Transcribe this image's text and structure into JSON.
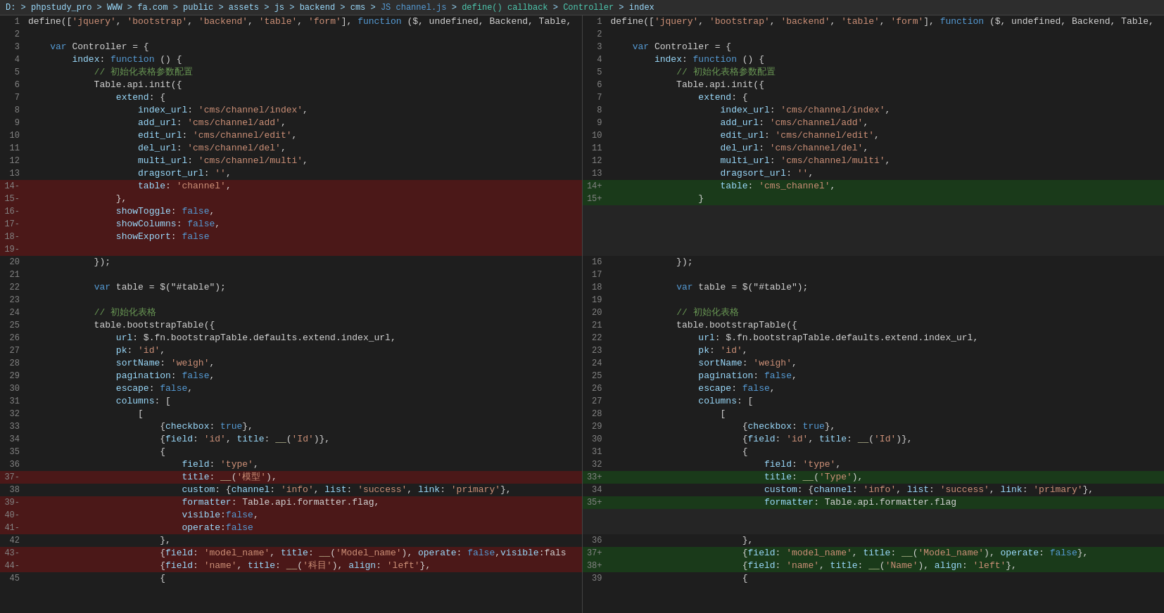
{
  "breadcrumb": {
    "items": [
      "D:",
      "phpstudy_pro",
      "WWW",
      "fa.com",
      "public",
      "assets",
      "js",
      "backend",
      "cms",
      "JS channel.js",
      "define() callback",
      "Controller",
      "index"
    ]
  },
  "left_pane": {
    "lines": [
      {
        "num": 1,
        "type": "normal",
        "content": "define(['jquery', 'bootstrap', 'backend', 'table', 'form'], function ($, undefined, Backend, Table,"
      },
      {
        "num": 2,
        "type": "normal",
        "content": ""
      },
      {
        "num": 3,
        "type": "normal",
        "content": "    var Controller = {"
      },
      {
        "num": 4,
        "type": "normal",
        "content": "        index: function () {"
      },
      {
        "num": 5,
        "type": "normal",
        "content": "            // 初始化表格参数配置"
      },
      {
        "num": 6,
        "type": "normal",
        "content": "            Table.api.init({"
      },
      {
        "num": 7,
        "type": "normal",
        "content": "                extend: {"
      },
      {
        "num": 8,
        "type": "normal",
        "content": "                    index_url: 'cms/channel/index',"
      },
      {
        "num": 9,
        "type": "normal",
        "content": "                    add_url: 'cms/channel/add',"
      },
      {
        "num": 10,
        "type": "normal",
        "content": "                    edit_url: 'cms/channel/edit',"
      },
      {
        "num": 11,
        "type": "normal",
        "content": "                    del_url: 'cms/channel/del',"
      },
      {
        "num": 12,
        "type": "normal",
        "content": "                    multi_url: 'cms/channel/multi',"
      },
      {
        "num": 13,
        "type": "normal",
        "content": "                    dragsort_url: '',"
      },
      {
        "num": "14-",
        "type": "deleted",
        "content": "                    table: 'channel',"
      },
      {
        "num": "15-",
        "type": "deleted",
        "content": "                },"
      },
      {
        "num": "16-",
        "type": "deleted",
        "content": "                showToggle: false,"
      },
      {
        "num": "17-",
        "type": "deleted",
        "content": "                showColumns: false,"
      },
      {
        "num": "18-",
        "type": "deleted",
        "content": "                showExport: false"
      },
      {
        "num": "19-",
        "type": "deleted",
        "content": ""
      },
      {
        "num": 20,
        "type": "normal",
        "content": "            });"
      },
      {
        "num": 21,
        "type": "normal",
        "content": ""
      },
      {
        "num": 22,
        "type": "normal",
        "content": "            var table = $(\"#table\");"
      },
      {
        "num": 23,
        "type": "normal",
        "content": ""
      },
      {
        "num": 24,
        "type": "normal",
        "content": "            // 初始化表格"
      },
      {
        "num": 25,
        "type": "normal",
        "content": "            table.bootstrapTable({"
      },
      {
        "num": 26,
        "type": "normal",
        "content": "                url: $.fn.bootstrapTable.defaults.extend.index_url,"
      },
      {
        "num": 27,
        "type": "normal",
        "content": "                pk: 'id',"
      },
      {
        "num": 28,
        "type": "normal",
        "content": "                sortName: 'weigh',"
      },
      {
        "num": 29,
        "type": "normal",
        "content": "                pagination: false,"
      },
      {
        "num": 30,
        "type": "normal",
        "content": "                escape: false,"
      },
      {
        "num": 31,
        "type": "normal",
        "content": "                columns: ["
      },
      {
        "num": 32,
        "type": "normal",
        "content": "                    ["
      },
      {
        "num": 33,
        "type": "normal",
        "content": "                        {checkbox: true},"
      },
      {
        "num": 34,
        "type": "normal",
        "content": "                        {field: 'id', title: __('Id')},"
      },
      {
        "num": 35,
        "type": "normal",
        "content": "                        {"
      },
      {
        "num": 36,
        "type": "normal",
        "content": "                            field: 'type',"
      },
      {
        "num": "37-",
        "type": "deleted",
        "content": "                            title: __('模型'),"
      },
      {
        "num": 38,
        "type": "normal",
        "content": "                            custom: {channel: 'info', list: 'success', link: 'primary'},"
      },
      {
        "num": "39-",
        "type": "deleted",
        "content": "                            formatter: Table.api.formatter.flag,"
      },
      {
        "num": "40-",
        "type": "deleted",
        "content": "                            visible:false,"
      },
      {
        "num": "41-",
        "type": "deleted",
        "content": "                            operate:false"
      },
      {
        "num": 42,
        "type": "normal",
        "content": "                        },"
      },
      {
        "num": "43-",
        "type": "deleted",
        "content": "                        {field: 'model_name', title: __('Model_name'), operate: false,visible:fals"
      },
      {
        "num": "44-",
        "type": "deleted",
        "content": "                        {field: 'name', title: __('科目'), align: 'left'},"
      },
      {
        "num": 45,
        "type": "normal",
        "content": "                        {"
      }
    ]
  },
  "right_pane": {
    "lines": [
      {
        "num": 1,
        "type": "normal",
        "content": "define(['jquery', 'bootstrap', 'backend', 'table', 'form'], function ($, undefined, Backend, Table,"
      },
      {
        "num": 2,
        "type": "normal",
        "content": ""
      },
      {
        "num": 3,
        "type": "normal",
        "content": "    var Controller = {"
      },
      {
        "num": 4,
        "type": "normal",
        "content": "        index: function () {"
      },
      {
        "num": 5,
        "type": "normal",
        "content": "            // 初始化表格参数配置"
      },
      {
        "num": 6,
        "type": "normal",
        "content": "            Table.api.init({"
      },
      {
        "num": 7,
        "type": "normal",
        "content": "                extend: {"
      },
      {
        "num": 8,
        "type": "normal",
        "content": "                    index_url: 'cms/channel/index',"
      },
      {
        "num": 9,
        "type": "normal",
        "content": "                    add_url: 'cms/channel/add',"
      },
      {
        "num": 10,
        "type": "normal",
        "content": "                    edit_url: 'cms/channel/edit',"
      },
      {
        "num": 11,
        "type": "normal",
        "content": "                    del_url: 'cms/channel/del',"
      },
      {
        "num": 12,
        "type": "normal",
        "content": "                    multi_url: 'cms/channel/multi',"
      },
      {
        "num": 13,
        "type": "normal",
        "content": "                    dragsort_url: '',"
      },
      {
        "num": "14+",
        "type": "added",
        "content": "                    table: 'cms_channel',"
      },
      {
        "num": "15+",
        "type": "added",
        "content": "                }"
      },
      {
        "num": "",
        "type": "empty",
        "content": ""
      },
      {
        "num": "",
        "type": "empty",
        "content": ""
      },
      {
        "num": "",
        "type": "empty",
        "content": ""
      },
      {
        "num": "",
        "type": "empty",
        "content": ""
      },
      {
        "num": 16,
        "type": "normal",
        "content": "            });"
      },
      {
        "num": 17,
        "type": "normal",
        "content": ""
      },
      {
        "num": 18,
        "type": "normal",
        "content": "            var table = $(\"#table\");"
      },
      {
        "num": 19,
        "type": "normal",
        "content": ""
      },
      {
        "num": 20,
        "type": "normal",
        "content": "            // 初始化表格"
      },
      {
        "num": 21,
        "type": "normal",
        "content": "            table.bootstrapTable({"
      },
      {
        "num": 22,
        "type": "normal",
        "content": "                url: $.fn.bootstrapTable.defaults.extend.index_url,"
      },
      {
        "num": 23,
        "type": "normal",
        "content": "                pk: 'id',"
      },
      {
        "num": 24,
        "type": "normal",
        "content": "                sortName: 'weigh',"
      },
      {
        "num": 25,
        "type": "normal",
        "content": "                pagination: false,"
      },
      {
        "num": 26,
        "type": "normal",
        "content": "                escape: false,"
      },
      {
        "num": 27,
        "type": "normal",
        "content": "                columns: ["
      },
      {
        "num": 28,
        "type": "normal",
        "content": "                    ["
      },
      {
        "num": 29,
        "type": "normal",
        "content": "                        {checkbox: true},"
      },
      {
        "num": 30,
        "type": "normal",
        "content": "                        {field: 'id', title: __('Id')},"
      },
      {
        "num": 31,
        "type": "normal",
        "content": "                        {"
      },
      {
        "num": 32,
        "type": "normal",
        "content": "                            field: 'type',"
      },
      {
        "num": "33+",
        "type": "added",
        "content": "                            title: __('Type'),"
      },
      {
        "num": 34,
        "type": "normal",
        "content": "                            custom: {channel: 'info', list: 'success', link: 'primary'},"
      },
      {
        "num": "35+",
        "type": "added",
        "content": "                            formatter: Table.api.formatter.flag"
      },
      {
        "num": "",
        "type": "empty",
        "content": ""
      },
      {
        "num": "",
        "type": "empty",
        "content": ""
      },
      {
        "num": 36,
        "type": "normal",
        "content": "                        },"
      },
      {
        "num": "37+",
        "type": "added",
        "content": "                        {field: 'model_name', title: __('Model_name'), operate: false},"
      },
      {
        "num": "38+",
        "type": "added",
        "content": "                        {field: 'name', title: __('Name'), align: 'left'},"
      },
      {
        "num": 39,
        "type": "normal",
        "content": "                        {"
      }
    ]
  }
}
